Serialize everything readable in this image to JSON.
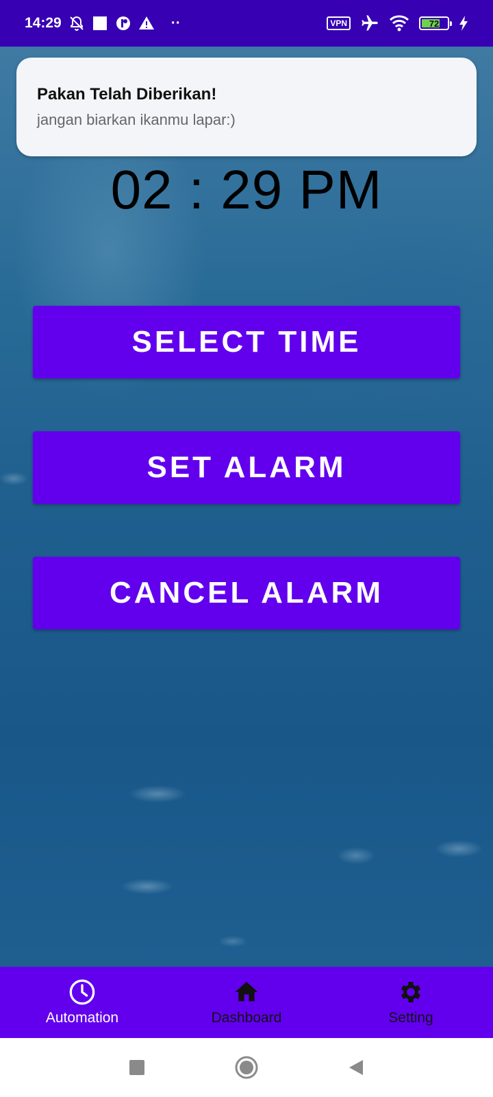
{
  "status_bar": {
    "time": "14:29",
    "left_icons": [
      "bell-off-icon",
      "square-icon",
      "app-notification-icon",
      "warning-icon",
      "more-dots-icon"
    ],
    "right_icons": [
      "vpn-icon",
      "airplane-icon",
      "wifi-icon",
      "battery-icon",
      "charging-icon"
    ],
    "vpn_label": "VPN",
    "battery_level": "72",
    "more_dots": "··"
  },
  "notification": {
    "title": "Pakan Telah Diberikan!",
    "body": "jangan biarkan ikanmu lapar:)"
  },
  "clock": {
    "time_text": "02 : 29 PM"
  },
  "actions": {
    "select_time": "SELECT TIME",
    "set_alarm": "SET ALARM",
    "cancel_alarm": "CANCEL ALARM"
  },
  "bottom_nav": {
    "items": [
      {
        "label": "Automation",
        "icon": "clock-icon",
        "active": true
      },
      {
        "label": "Dashboard",
        "icon": "home-icon",
        "active": false
      },
      {
        "label": "Setting",
        "icon": "gear-icon",
        "active": false
      }
    ]
  },
  "system_nav": {
    "icons": [
      "recents-square-icon",
      "home-circle-icon",
      "back-triangle-icon"
    ]
  },
  "colors": {
    "status_bar": "#3700b3",
    "primary": "#6200ee",
    "nav_active": "#ffffff",
    "nav_inactive": "#111111"
  }
}
